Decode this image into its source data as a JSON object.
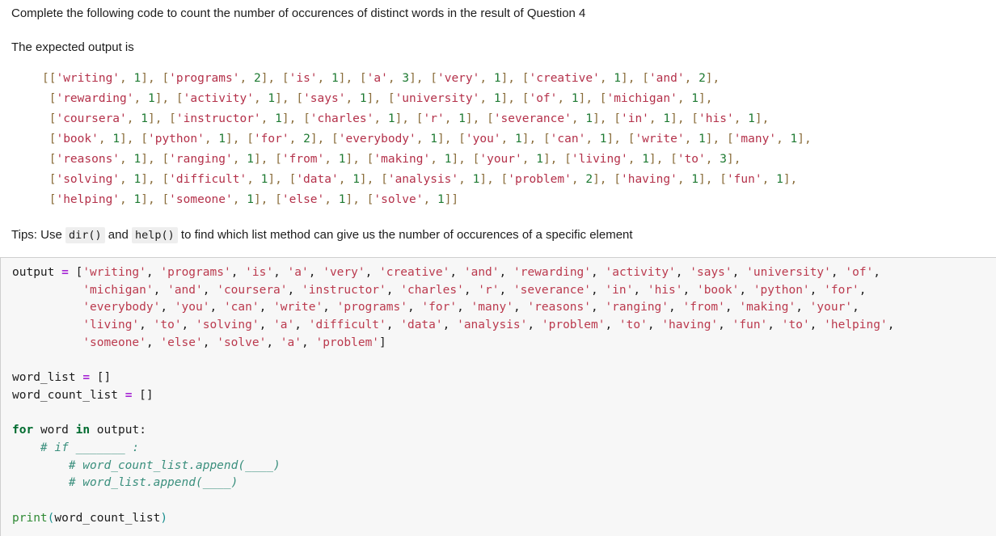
{
  "instruction": "Complete the following code to count the number of occurences of distinct words in the result of Question 4",
  "expected_label": "The expected output is",
  "expected_output": {
    "lines": [
      "[['writing', 1], ['programs', 2], ['is', 1], ['a', 3], ['very', 1], ['creative', 1], ['and', 2],",
      " ['rewarding', 1], ['activity', 1], ['says', 1], ['university', 1], ['of', 1], ['michigan', 1],",
      " ['coursera', 1], ['instructor', 1], ['charles', 1], ['r', 1], ['severance', 1], ['in', 1], ['his', 1],",
      " ['book', 1], ['python', 1], ['for', 2], ['everybody', 1], ['you', 1], ['can', 1], ['write', 1], ['many', 1],",
      " ['reasons', 1], ['ranging', 1], ['from', 1], ['making', 1], ['your', 1], ['living', 1], ['to', 3],",
      " ['solving', 1], ['difficult', 1], ['data', 1], ['analysis', 1], ['problem', 2], ['having', 1], ['fun', 1],",
      " ['helping', 1], ['someone', 1], ['else', 1], ['solve', 1]]"
    ],
    "pairs": [
      [
        "writing",
        1
      ],
      [
        "programs",
        2
      ],
      [
        "is",
        1
      ],
      [
        "a",
        3
      ],
      [
        "very",
        1
      ],
      [
        "creative",
        1
      ],
      [
        "and",
        2
      ],
      [
        "rewarding",
        1
      ],
      [
        "activity",
        1
      ],
      [
        "says",
        1
      ],
      [
        "university",
        1
      ],
      [
        "of",
        1
      ],
      [
        "michigan",
        1
      ],
      [
        "coursera",
        1
      ],
      [
        "instructor",
        1
      ],
      [
        "charles",
        1
      ],
      [
        "r",
        1
      ],
      [
        "severance",
        1
      ],
      [
        "in",
        1
      ],
      [
        "his",
        1
      ],
      [
        "book",
        1
      ],
      [
        "python",
        1
      ],
      [
        "for",
        2
      ],
      [
        "everybody",
        1
      ],
      [
        "you",
        1
      ],
      [
        "can",
        1
      ],
      [
        "write",
        1
      ],
      [
        "many",
        1
      ],
      [
        "reasons",
        1
      ],
      [
        "ranging",
        1
      ],
      [
        "from",
        1
      ],
      [
        "making",
        1
      ],
      [
        "your",
        1
      ],
      [
        "living",
        1
      ],
      [
        "to",
        3
      ],
      [
        "solving",
        1
      ],
      [
        "difficult",
        1
      ],
      [
        "data",
        1
      ],
      [
        "analysis",
        1
      ],
      [
        "problem",
        2
      ],
      [
        "having",
        1
      ],
      [
        "fun",
        1
      ],
      [
        "helping",
        1
      ],
      [
        "someone",
        1
      ],
      [
        "else",
        1
      ],
      [
        "solve",
        1
      ]
    ]
  },
  "tips": {
    "prefix": "Tips: Use ",
    "code_1": "dir()",
    "middle": " and ",
    "code_2": "help()",
    "suffix": " to find which list method can give us the number of occurences of a specific element"
  },
  "code_cell": {
    "variable_name": "output",
    "assign_operator": "=",
    "output_words": [
      "writing",
      "programs",
      "is",
      "a",
      "very",
      "creative",
      "and",
      "rewarding",
      "activity",
      "says",
      "university",
      "of",
      "michigan",
      "and",
      "coursera",
      "instructor",
      "charles",
      "r",
      "severance",
      "in",
      "his",
      "book",
      "python",
      "for",
      "everybody",
      "you",
      "can",
      "write",
      "programs",
      "for",
      "many",
      "reasons",
      "ranging",
      "from",
      "making",
      "your",
      "living",
      "to",
      "solving",
      "a",
      "difficult",
      "data",
      "analysis",
      "problem",
      "to",
      "having",
      "fun",
      "to",
      "helping",
      "someone",
      "else",
      "solve",
      "a",
      "problem"
    ],
    "lines_plain": [
      "output = ['writing', 'programs', 'is', 'a', 'very', 'creative', 'and', 'rewarding', 'activity', 'says', 'university', 'of',",
      "          'michigan', 'and', 'coursera', 'instructor', 'charles', 'r', 'severance', 'in', 'his', 'book', 'python', 'for',",
      "          'everybody', 'you', 'can', 'write', 'programs', 'for', 'many', 'reasons', 'ranging', 'from', 'making', 'your',",
      "          'living', 'to', 'solving', 'a', 'difficult', 'data', 'analysis', 'problem', 'to', 'having', 'fun', 'to', 'helping',",
      "          'someone', 'else', 'solve', 'a', 'problem']",
      "",
      "word_list = []",
      "word_count_list = []",
      "",
      "for word in output:",
      "    # if _______ :",
      "        # word_count_list.append(____)",
      "        # word_list.append(____)",
      "",
      "print(word_count_list)"
    ],
    "word_list_name": "word_list",
    "word_count_list_name": "word_count_list",
    "empty_list": "[]",
    "keyword_for": "for",
    "loop_var": "word",
    "keyword_in": "in",
    "loop_iterable": "output:",
    "comment_if": "# if _______ :",
    "comment_append_count": "# word_count_list.append(____)",
    "comment_append_word": "# word_list.append(____)",
    "print_name": "print",
    "print_arg": "(word_count_list)"
  },
  "colors": {
    "string": "#bb3a4e",
    "number": "#1e7a32",
    "keyword": "#006b2f",
    "operator": "#a626d4",
    "comment": "#3a8f7d",
    "builtin": "#2f8a34",
    "punct": "#8a6d3b",
    "code_bg": "#f7f7f7",
    "code_border": "#cfcfcf",
    "page_bg": "#ffffff",
    "text": "#1c1c1c"
  }
}
